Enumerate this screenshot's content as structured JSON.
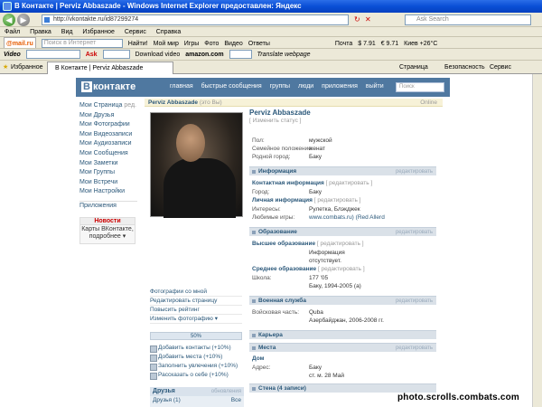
{
  "window": {
    "title": "В Контакте | Perviz Abbaszade - Windows Internet Explorer предоставлен: Яндекс"
  },
  "address": {
    "url": "http://vkontakte.ru/id87299274",
    "search_placeholder": "Ask Search"
  },
  "menu": [
    "Файл",
    "Правка",
    "Вид",
    "Избранное",
    "Сервис",
    "Справка"
  ],
  "toolbar1": {
    "mailru": "@mail.ru",
    "search_placeholder": "Поиск в Интернет",
    "find": "Найти!",
    "items": [
      "Мой мир",
      "Игры",
      "Фото",
      "Видео",
      "Ответы"
    ],
    "mail": "Почта",
    "usd": "$ 7.91",
    "eur": "€ 9.71",
    "weather": "Киев +26°C"
  },
  "toolbar2": {
    "video": "Video",
    "ask": "Ask",
    "download": "Download video",
    "amazon": "amazon.com",
    "translate": "Translate webpage"
  },
  "tabs": {
    "favorites": "Избранное",
    "active": "В Контакте | Perviz Abbaszade",
    "right": [
      "Страница",
      "Безопасность",
      "Сервис"
    ]
  },
  "vk": {
    "logo": "контакте",
    "logo_b": "В",
    "nav": [
      "главная",
      "быстрые сообщения",
      "группы",
      "люди",
      "приложения",
      "выйти"
    ],
    "search_placeholder": "Поиск",
    "left_menu": [
      "Мои Страница",
      "Мои Друзья",
      "Мои Фотографии",
      "Мои Видеозаписи",
      "Мои Аудиозаписи",
      "Мои Сообщения",
      "Мои Заметки",
      "Мои Группы",
      "Мои Встречи",
      "Мои Настройки"
    ],
    "left_menu_edit": "ред.",
    "apps": "Приложения",
    "news_title": "Новости",
    "news_body": "Карты ВКонтакте, подробнее ▾",
    "header_bar": "Perviz Abbaszade",
    "online": "(это Вы)",
    "online_right": "Online",
    "name": "Perviz Abbaszade",
    "status": "[ Изменить статус ]",
    "basic": [
      {
        "k": "Пол:",
        "v": "мужской"
      },
      {
        "k": "Семейное положение:",
        "v": "женат"
      },
      {
        "k": "Родной город:",
        "v": "Баку"
      }
    ],
    "edit": "редактировать",
    "edit_br": "[ редактировать ]",
    "info": "Информация",
    "contact": "Контактная информация",
    "contact_rows": [
      {
        "k": "Город:",
        "v": "Баку"
      }
    ],
    "personal": "Личная информация",
    "personal_rows": [
      {
        "k": "Интересы:",
        "v": "Рулетка, Блэкджек"
      },
      {
        "k": "Любимые игры:",
        "v": "www.combats.ru) (Red Allerd"
      }
    ],
    "education": "Образование",
    "higher": "Высшее образование",
    "higher_rows": [
      {
        "k": "",
        "v": "Информация"
      },
      {
        "k": "",
        "v": "отсутствует."
      }
    ],
    "secondary": "Среднее образование",
    "secondary_rows": [
      {
        "k": "Школа:",
        "v": "177 '05"
      },
      {
        "k": "",
        "v": "Баку, 1994-2005 (а)"
      }
    ],
    "military": "Военная служба",
    "military_rows": [
      {
        "k": "Войсковая часть:",
        "v": "Quba"
      },
      {
        "k": "",
        "v": "Азербайджан, 2006-2008 гг."
      }
    ],
    "career": "Карьера",
    "places": "Места",
    "home": "Дом",
    "places_rows": [
      {
        "k": "Адрес:",
        "v": "Баку"
      },
      {
        "k": "",
        "v": "ст. м. 28 Май"
      }
    ],
    "wall": "Стена (4 записи)",
    "photo_actions": [
      "Фотографии со мной",
      "Редактировать страницу",
      "Повысить рейтинг",
      "Изменить фотографию ▾"
    ],
    "progress": "50%",
    "improve": [
      "Добавить контакты (+10%)",
      "Добавить места (+10%)",
      "Заполнить увлечения (+10%)",
      "Рассказать о себе (+10%)"
    ],
    "friends_title": "Друзья",
    "friends_edit": "обновления",
    "friends_row": "Друзья (1)",
    "friends_all": "Все"
  },
  "watermark": "photo.scrolls.combats.com"
}
